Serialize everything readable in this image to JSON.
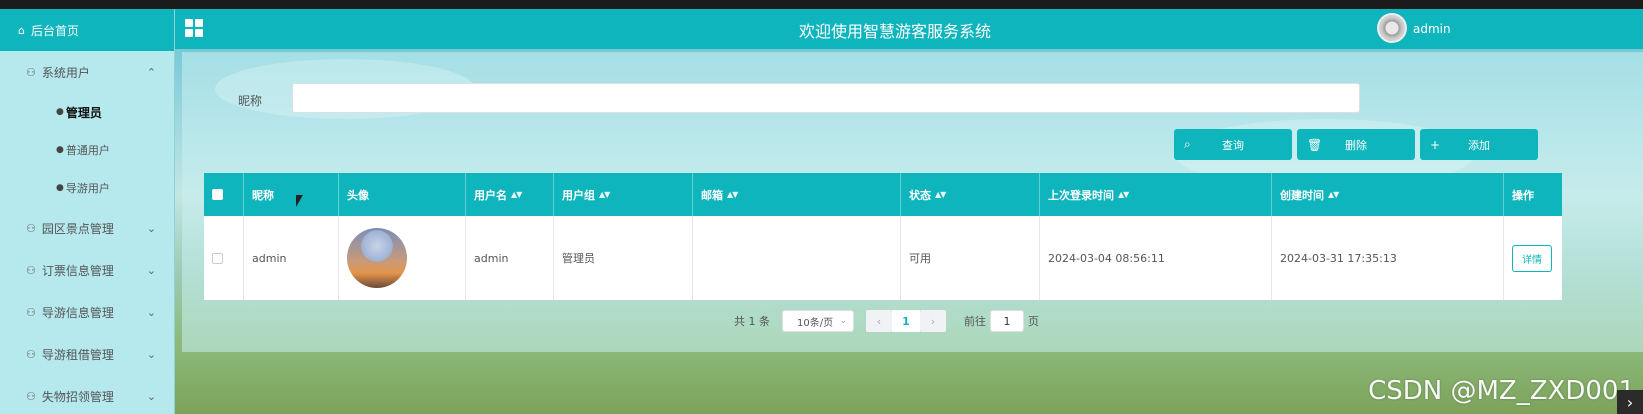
{
  "app": {
    "title": "欢迎使用智慧游客服务系统",
    "username": "admin",
    "accent_color": "#0fb5bd"
  },
  "sidebar": {
    "home": {
      "label": "后台首页",
      "icon": "home-icon"
    },
    "menus": [
      {
        "label": "系统用户",
        "icon": "user-icon",
        "expanded": true,
        "subitems": [
          {
            "label": "管理员",
            "active": true
          },
          {
            "label": "普通用户",
            "active": false
          },
          {
            "label": "导游用户",
            "active": false
          }
        ]
      },
      {
        "label": "园区景点管理",
        "icon": "user-icon",
        "expanded": false
      },
      {
        "label": "订票信息管理",
        "icon": "user-icon",
        "expanded": false
      },
      {
        "label": "导游信息管理",
        "icon": "user-icon",
        "expanded": false
      },
      {
        "label": "导游租借管理",
        "icon": "user-icon",
        "expanded": false
      },
      {
        "label": "失物招领管理",
        "icon": "user-icon",
        "expanded": false
      }
    ]
  },
  "search": {
    "label": "昵称",
    "value": "",
    "placeholder": ""
  },
  "actions": {
    "query": "查询",
    "delete": "删除",
    "add": "添加"
  },
  "table": {
    "columns": [
      "昵称",
      "头像",
      "用户名",
      "用户组",
      "邮箱",
      "状态",
      "上次登录时间",
      "创建时间",
      "操作"
    ],
    "rows": [
      {
        "nickname": "admin",
        "avatar": "avatar-image",
        "username": "admin",
        "group": "管理员",
        "email": "",
        "status": "可用",
        "last_login": "2024-03-04 08:56:11",
        "created": "2024-03-31 17:35:13",
        "action": "详情"
      }
    ]
  },
  "pagination": {
    "total": "共 1 条",
    "page_size": "10条/页",
    "current_page": "1",
    "goto_prefix": "前往",
    "goto_value": "1",
    "goto_suffix": "页"
  },
  "watermark": "CSDN @MZ_ZXD001"
}
